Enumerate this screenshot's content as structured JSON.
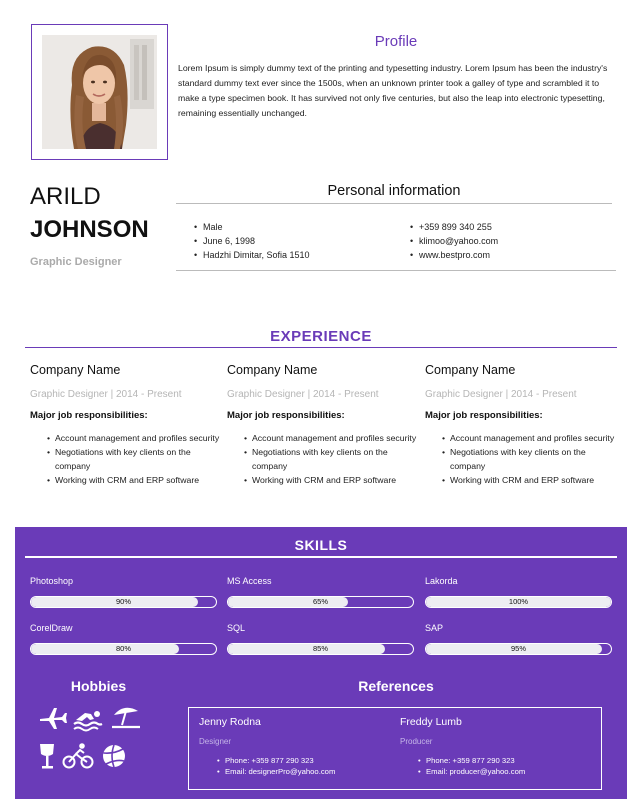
{
  "profile": {
    "title": "Profile",
    "text": "Lorem Ipsum is simply dummy text of the printing and typesetting industry. Lorem Ipsum has been the industry's standard dummy text ever since the 1500s, when an unknown printer took a galley of type and scrambled it to make a type specimen book. It has survived not only five centuries, but also the leap into electronic typesetting, remaining essentially unchanged."
  },
  "person": {
    "first_name": "ARILD",
    "last_name": "JOHNSON",
    "job_title": "Graphic Designer"
  },
  "personal_info": {
    "title": "Personal information",
    "left": [
      "Male",
      "June 6, 1998",
      "Hadzhi Dimitar, Sofia 1510"
    ],
    "right": [
      "+359 899 340 255",
      "klimoo@yahoo.com",
      "www.bestpro.com"
    ]
  },
  "experience": {
    "title": "EXPERIENCE",
    "jobs": [
      {
        "company": "Company Name",
        "role": "Graphic Designer | 2014 - Present",
        "resp_label": "Major job responsibilities:",
        "items": [
          "Account management and profiles security",
          "Negotiations with key clients on the company",
          "Working with CRM and ERP software"
        ]
      },
      {
        "company": "Company Name",
        "role": "Graphic Designer | 2014 - Present",
        "resp_label": "Major job responsibilities:",
        "items": [
          "Account management and profiles security",
          "Negotiations with key clients on the company",
          "Working with CRM and ERP software"
        ]
      },
      {
        "company": "Company Name",
        "role": "Graphic Designer | 2014 - Present",
        "resp_label": "Major job responsibilities:",
        "items": [
          "Account management and profiles security",
          "Negotiations with key clients on the company",
          "Working with CRM and ERP software"
        ]
      }
    ]
  },
  "skills": {
    "title": "SKILLS",
    "items": [
      {
        "name": "Photoshop",
        "label": "90%",
        "level": 0.9
      },
      {
        "name": "MS Access",
        "label": "65%",
        "level": 0.65
      },
      {
        "name": "Lakorda",
        "label": "100%",
        "level": 1.0
      },
      {
        "name": "CorelDraw",
        "label": "80%",
        "level": 0.8
      },
      {
        "name": "SQL",
        "label": "85%",
        "level": 0.85
      },
      {
        "name": "SAP",
        "label": "95%",
        "level": 0.95
      }
    ]
  },
  "hobbies": {
    "title": "Hobbies",
    "icons": [
      "airplane-icon",
      "swimmer-icon",
      "beach-umbrella-icon",
      "wine-glass-icon",
      "cycling-icon",
      "volleyball-icon"
    ]
  },
  "references": {
    "title": "References",
    "items": [
      {
        "name": "Jenny Rodna",
        "role": "Designer",
        "phone": "Phone: +359 877 290 323",
        "email": "Email: designerPro@yahoo.com"
      },
      {
        "name": "Freddy Lumb",
        "role": "Producer",
        "phone": "Phone: +359 877 290 323",
        "email": "Email: producer@yahoo.com"
      }
    ]
  },
  "colors": {
    "accent": "#6a3bb8",
    "white": "#ffffff",
    "muted": "#aaaaaa"
  }
}
